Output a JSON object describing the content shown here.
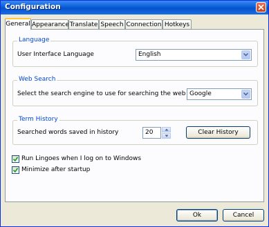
{
  "window": {
    "title": "Configuration"
  },
  "tabs": [
    {
      "label": "General"
    },
    {
      "label": "Appearance"
    },
    {
      "label": "Translate"
    },
    {
      "label": "Speech"
    },
    {
      "label": "Connection"
    },
    {
      "label": "Hotkeys"
    }
  ],
  "language": {
    "group_title": "Language",
    "label": "User Interface Language",
    "selected": "English"
  },
  "web_search": {
    "group_title": "Web Search",
    "label": "Select the search engine to use for searching the web",
    "selected": "Google"
  },
  "term_history": {
    "group_title": "Term History",
    "label": "Searched words saved in history",
    "count": "20",
    "clear_label": "Clear History"
  },
  "options": [
    {
      "label": "Run Lingoes when I log on to Windows",
      "checked": true
    },
    {
      "label": "Minimize after startup",
      "checked": true
    }
  ],
  "footer": {
    "ok_label": "Ok",
    "cancel_label": "Cancel"
  },
  "colors": {
    "accent": "#0046d5",
    "titlebar": "#0a5fd8",
    "tab_highlight": "#ffc83c"
  }
}
